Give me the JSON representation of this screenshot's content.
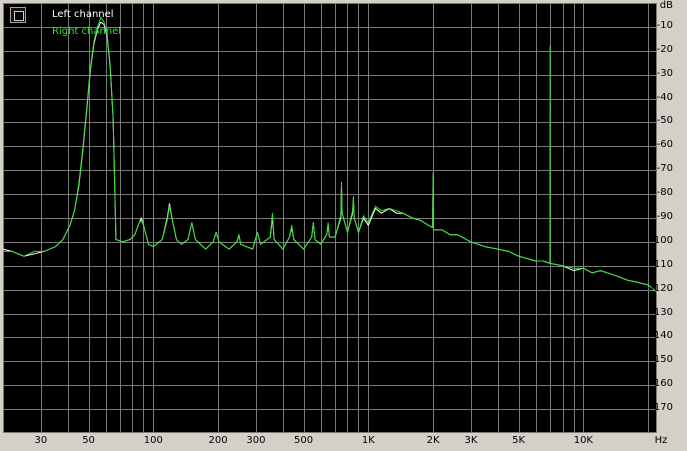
{
  "chart_data": {
    "type": "line",
    "title": "",
    "ylabel": "dB",
    "xlabel": "Hz",
    "x_scale": "log",
    "xlim": [
      20,
      22000
    ],
    "ylim": [
      -180,
      0
    ],
    "y_ticks": [
      -10,
      -20,
      -30,
      -40,
      -50,
      -60,
      -70,
      -80,
      -90,
      -100,
      -110,
      -120,
      -130,
      -140,
      -150,
      -160,
      -170
    ],
    "x_ticks": [
      {
        "value": 30,
        "label": "30"
      },
      {
        "value": 50,
        "label": "50"
      },
      {
        "value": 100,
        "label": "100"
      },
      {
        "value": 200,
        "label": "200"
      },
      {
        "value": 300,
        "label": "300"
      },
      {
        "value": 500,
        "label": "500"
      },
      {
        "value": 1000,
        "label": "1K"
      },
      {
        "value": 2000,
        "label": "2K"
      },
      {
        "value": 3000,
        "label": "3K"
      },
      {
        "value": 5000,
        "label": "5K"
      },
      {
        "value": 10000,
        "label": "10K"
      }
    ],
    "grid": true,
    "legend_position": "top-left",
    "background_color": "#000000",
    "grid_color": "#7a7a7a",
    "series": [
      {
        "name": "Left channel",
        "color": "#ffffff",
        "points": [
          [
            20,
            -103
          ],
          [
            22,
            -104
          ],
          [
            25,
            -106
          ],
          [
            28,
            -105
          ],
          [
            31,
            -104
          ],
          [
            35,
            -102
          ],
          [
            38,
            -99
          ],
          [
            41,
            -93
          ],
          [
            43,
            -87
          ],
          [
            45,
            -77
          ],
          [
            47,
            -62
          ],
          [
            49,
            -45
          ],
          [
            51,
            -28
          ],
          [
            53,
            -17
          ],
          [
            55,
            -11
          ],
          [
            57,
            -8
          ],
          [
            59,
            -9
          ],
          [
            61,
            -14
          ],
          [
            63,
            -27
          ],
          [
            65,
            -48
          ],
          [
            66,
            -72
          ],
          [
            67,
            -99
          ],
          [
            72,
            -100
          ],
          [
            78,
            -99
          ],
          [
            82,
            -97
          ],
          [
            86,
            -92
          ],
          [
            88,
            -90
          ],
          [
            90,
            -93
          ],
          [
            95,
            -101
          ],
          [
            100,
            -102
          ],
          [
            110,
            -99
          ],
          [
            116,
            -90
          ],
          [
            119,
            -84
          ],
          [
            122,
            -90
          ],
          [
            128,
            -99
          ],
          [
            135,
            -101
          ],
          [
            145,
            -99
          ],
          [
            151,
            -92
          ],
          [
            157,
            -99
          ],
          [
            175,
            -103
          ],
          [
            190,
            -100
          ],
          [
            196,
            -96
          ],
          [
            202,
            -100
          ],
          [
            225,
            -103
          ],
          [
            245,
            -100
          ],
          [
            250,
            -97
          ],
          [
            255,
            -101
          ],
          [
            290,
            -103
          ],
          [
            305,
            -96
          ],
          [
            315,
            -101
          ],
          [
            350,
            -98
          ],
          [
            358,
            -90
          ],
          [
            365,
            -99
          ],
          [
            400,
            -103
          ],
          [
            430,
            -98
          ],
          [
            440,
            -94
          ],
          [
            450,
            -99
          ],
          [
            500,
            -103
          ],
          [
            545,
            -98
          ],
          [
            555,
            -92
          ],
          [
            565,
            -99
          ],
          [
            600,
            -101
          ],
          [
            640,
            -97
          ],
          [
            650,
            -93
          ],
          [
            660,
            -98
          ],
          [
            700,
            -98
          ],
          [
            745,
            -90
          ],
          [
            750,
            -76
          ],
          [
            755,
            -88
          ],
          [
            800,
            -96
          ],
          [
            845,
            -88
          ],
          [
            852,
            -82
          ],
          [
            860,
            -90
          ],
          [
            900,
            -96
          ],
          [
            950,
            -90
          ],
          [
            1000,
            -93
          ],
          [
            1080,
            -86
          ],
          [
            1150,
            -88
          ],
          [
            1250,
            -86
          ],
          [
            1350,
            -88
          ],
          [
            1450,
            -88
          ],
          [
            1600,
            -90
          ],
          [
            1750,
            -91
          ],
          [
            1900,
            -93
          ],
          [
            1990,
            -94
          ],
          [
            2000,
            -73
          ],
          [
            2010,
            -95
          ],
          [
            2200,
            -95
          ],
          [
            2400,
            -97
          ],
          [
            2600,
            -97
          ],
          [
            3000,
            -100
          ],
          [
            3500,
            -102
          ],
          [
            4000,
            -103
          ],
          [
            4500,
            -104
          ],
          [
            5000,
            -106
          ],
          [
            5500,
            -107
          ],
          [
            6000,
            -108
          ],
          [
            6500,
            -108
          ],
          [
            7000,
            -109
          ],
          [
            8000,
            -110
          ],
          [
            9000,
            -112
          ],
          [
            10000,
            -111
          ],
          [
            11000,
            -113
          ],
          [
            12000,
            -112
          ],
          [
            14000,
            -114
          ],
          [
            16000,
            -116
          ],
          [
            18000,
            -117
          ],
          [
            20000,
            -118
          ],
          [
            22000,
            -121
          ]
        ]
      },
      {
        "name": "Right channel",
        "color": "#33dd33",
        "points": [
          [
            20,
            -104
          ],
          [
            22,
            -104
          ],
          [
            25,
            -106
          ],
          [
            28,
            -104
          ],
          [
            31,
            -104
          ],
          [
            35,
            -102
          ],
          [
            38,
            -99
          ],
          [
            41,
            -93
          ],
          [
            43,
            -87
          ],
          [
            45,
            -76
          ],
          [
            47,
            -61
          ],
          [
            49,
            -44
          ],
          [
            51,
            -27
          ],
          [
            53,
            -16
          ],
          [
            55,
            -10
          ],
          [
            57,
            -6
          ],
          [
            59,
            -8
          ],
          [
            61,
            -13
          ],
          [
            63,
            -26
          ],
          [
            65,
            -48
          ],
          [
            66,
            -72
          ],
          [
            67,
            -99
          ],
          [
            72,
            -100
          ],
          [
            78,
            -99
          ],
          [
            82,
            -97
          ],
          [
            86,
            -92
          ],
          [
            88,
            -91
          ],
          [
            90,
            -93
          ],
          [
            95,
            -101
          ],
          [
            100,
            -102
          ],
          [
            110,
            -99
          ],
          [
            116,
            -91
          ],
          [
            119,
            -85
          ],
          [
            122,
            -90
          ],
          [
            128,
            -99
          ],
          [
            135,
            -101
          ],
          [
            145,
            -99
          ],
          [
            151,
            -92
          ],
          [
            157,
            -99
          ],
          [
            175,
            -103
          ],
          [
            190,
            -100
          ],
          [
            196,
            -96
          ],
          [
            202,
            -100
          ],
          [
            225,
            -103
          ],
          [
            245,
            -100
          ],
          [
            250,
            -97
          ],
          [
            255,
            -101
          ],
          [
            290,
            -103
          ],
          [
            305,
            -96
          ],
          [
            315,
            -101
          ],
          [
            350,
            -98
          ],
          [
            358,
            -88
          ],
          [
            365,
            -99
          ],
          [
            400,
            -103
          ],
          [
            430,
            -98
          ],
          [
            440,
            -93
          ],
          [
            450,
            -99
          ],
          [
            500,
            -103
          ],
          [
            545,
            -98
          ],
          [
            555,
            -92
          ],
          [
            565,
            -99
          ],
          [
            600,
            -101
          ],
          [
            640,
            -97
          ],
          [
            650,
            -92
          ],
          [
            660,
            -98
          ],
          [
            700,
            -98
          ],
          [
            745,
            -89
          ],
          [
            750,
            -75
          ],
          [
            755,
            -88
          ],
          [
            800,
            -96
          ],
          [
            845,
            -87
          ],
          [
            852,
            -81
          ],
          [
            860,
            -90
          ],
          [
            900,
            -96
          ],
          [
            950,
            -89
          ],
          [
            1000,
            -92
          ],
          [
            1080,
            -85
          ],
          [
            1150,
            -87
          ],
          [
            1250,
            -86
          ],
          [
            1350,
            -87
          ],
          [
            1450,
            -88
          ],
          [
            1600,
            -90
          ],
          [
            1750,
            -91
          ],
          [
            1900,
            -93
          ],
          [
            1990,
            -94
          ],
          [
            2000,
            -71
          ],
          [
            2010,
            -95
          ],
          [
            2200,
            -95
          ],
          [
            2400,
            -97
          ],
          [
            2600,
            -97
          ],
          [
            3000,
            -100
          ],
          [
            3500,
            -102
          ],
          [
            4000,
            -103
          ],
          [
            4500,
            -104
          ],
          [
            5000,
            -106
          ],
          [
            5500,
            -107
          ],
          [
            6000,
            -108
          ],
          [
            6500,
            -108
          ],
          [
            6990,
            -109
          ],
          [
            7000,
            -18
          ],
          [
            7010,
            -109
          ],
          [
            8000,
            -110
          ],
          [
            9000,
            -111
          ],
          [
            10000,
            -111
          ],
          [
            11000,
            -113
          ],
          [
            12000,
            -112
          ],
          [
            14000,
            -114
          ],
          [
            16000,
            -116
          ],
          [
            18000,
            -117
          ],
          [
            20000,
            -118
          ],
          [
            22000,
            -121
          ]
        ]
      }
    ]
  }
}
